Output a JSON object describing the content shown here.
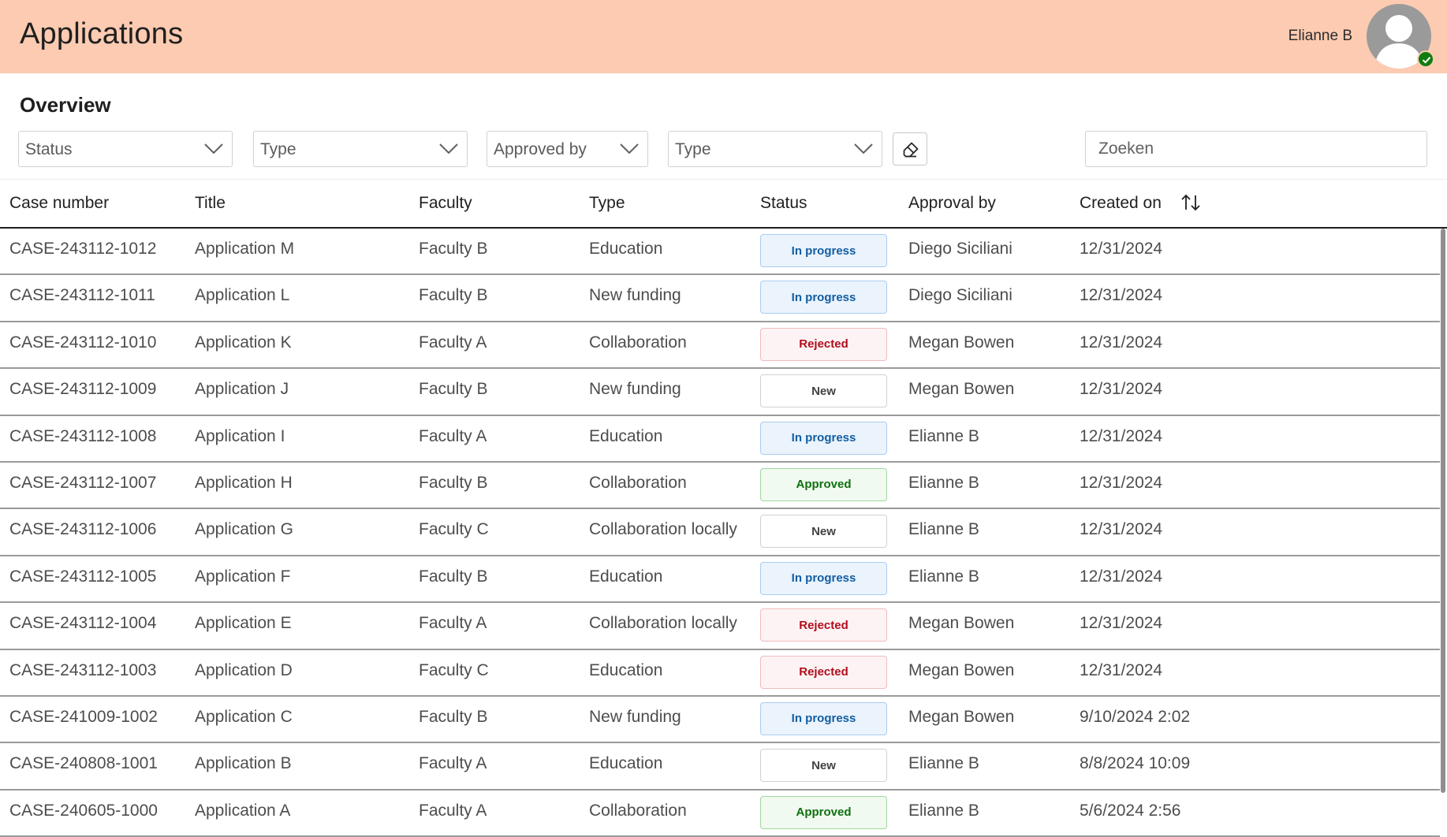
{
  "header": {
    "title": "Applications",
    "user_name": "Elianne B",
    "presence": "available",
    "background": "#fccbb1"
  },
  "overview": {
    "title": "Overview",
    "filters": [
      {
        "label": "Status"
      },
      {
        "label": "Type"
      },
      {
        "label": "Approved by"
      },
      {
        "label": "Type"
      }
    ],
    "clear_icon": "eraser-icon",
    "search_placeholder": "Zoeken"
  },
  "table": {
    "columns": [
      "Case number",
      "Title",
      "Faculty",
      "Type",
      "Status",
      "Approval by",
      "Created on"
    ],
    "sort_icon": "sort-arrows-icon",
    "rows": [
      {
        "case": "CASE-243112-1012",
        "title": "Application M",
        "faculty": "Faculty B",
        "type": "Education",
        "status": "In progress",
        "status_kind": "in-progress",
        "approval": "Diego Siciliani",
        "created": "12/31/2024"
      },
      {
        "case": "CASE-243112-1011",
        "title": "Application L",
        "faculty": "Faculty B",
        "type": "New funding",
        "status": "In progress",
        "status_kind": "in-progress",
        "approval": "Diego Siciliani",
        "created": "12/31/2024"
      },
      {
        "case": "CASE-243112-1010",
        "title": "Application K",
        "faculty": "Faculty A",
        "type": "Collaboration",
        "status": "Rejected",
        "status_kind": "rejected",
        "approval": "Megan Bowen",
        "created": "12/31/2024"
      },
      {
        "case": "CASE-243112-1009",
        "title": "Application J",
        "faculty": "Faculty B",
        "type": "New funding",
        "status": "New",
        "status_kind": "new",
        "approval": "Megan Bowen",
        "created": "12/31/2024"
      },
      {
        "case": "CASE-243112-1008",
        "title": "Application I",
        "faculty": "Faculty A",
        "type": "Education",
        "status": "In progress",
        "status_kind": "in-progress",
        "approval": "Elianne B",
        "created": "12/31/2024"
      },
      {
        "case": "CASE-243112-1007",
        "title": "Application H",
        "faculty": "Faculty B",
        "type": "Collaboration",
        "status": "Approved",
        "status_kind": "approved",
        "approval": "Elianne B",
        "created": "12/31/2024"
      },
      {
        "case": "CASE-243112-1006",
        "title": "Application G",
        "faculty": "Faculty C",
        "type": "Collaboration locally",
        "status": "New",
        "status_kind": "new",
        "approval": "Elianne B",
        "created": "12/31/2024"
      },
      {
        "case": "CASE-243112-1005",
        "title": "Application F",
        "faculty": "Faculty B",
        "type": "Education",
        "status": "In progress",
        "status_kind": "in-progress",
        "approval": "Elianne B",
        "created": "12/31/2024"
      },
      {
        "case": "CASE-243112-1004",
        "title": "Application E",
        "faculty": "Faculty A",
        "type": "Collaboration locally",
        "status": "Rejected",
        "status_kind": "rejected",
        "approval": "Megan Bowen",
        "created": "12/31/2024"
      },
      {
        "case": "CASE-243112-1003",
        "title": "Application D",
        "faculty": "Faculty C",
        "type": "Education",
        "status": "Rejected",
        "status_kind": "rejected",
        "approval": "Megan Bowen",
        "created": "12/31/2024"
      },
      {
        "case": "CASE-241009-1002",
        "title": "Application C",
        "faculty": "Faculty B",
        "type": "New funding",
        "status": "In progress",
        "status_kind": "in-progress",
        "approval": "Megan Bowen",
        "created": "9/10/2024 2:02"
      },
      {
        "case": "CASE-240808-1001",
        "title": "Application B",
        "faculty": "Faculty A",
        "type": "Education",
        "status": "New",
        "status_kind": "new",
        "approval": "Elianne B",
        "created": "8/8/2024 10:09"
      },
      {
        "case": "CASE-240605-1000",
        "title": "Application A",
        "faculty": "Faculty A",
        "type": "Collaboration",
        "status": "Approved",
        "status_kind": "approved",
        "approval": "Elianne B",
        "created": "5/6/2024 2:56"
      }
    ]
  }
}
